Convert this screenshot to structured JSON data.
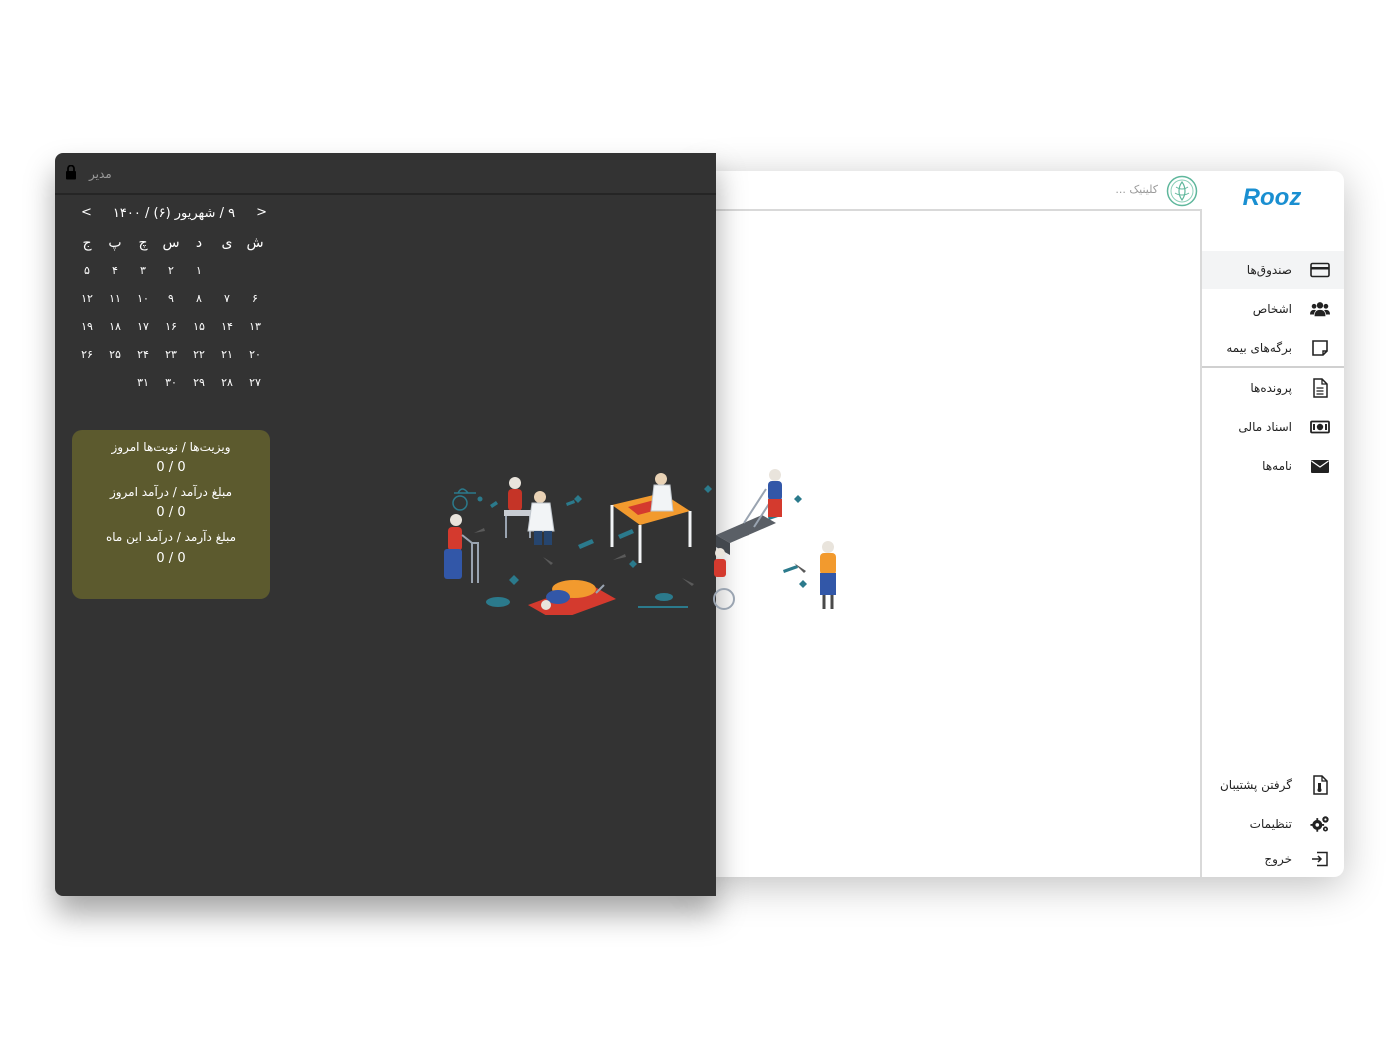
{
  "app": {
    "logo_text": "Rooz",
    "clinic_placeholder": "کلینیک ...",
    "brand_color": "#1a8fd1"
  },
  "sidebar": {
    "items": [
      {
        "label": "صندوق‌ها",
        "icon": "credit-card-icon",
        "active": true
      },
      {
        "label": "اشخاص",
        "icon": "users-icon"
      },
      {
        "label": "برگه‌های بیمه",
        "icon": "sticky-note-icon"
      },
      {
        "label": "پرونده‌ها",
        "icon": "document-icon"
      },
      {
        "label": "اسناد مالی",
        "icon": "money-bill-icon"
      },
      {
        "label": "نامه‌ها",
        "icon": "envelope-icon"
      }
    ],
    "bottom_items": [
      {
        "label": "گرفتن پشتیبان",
        "icon": "backup-file-icon"
      },
      {
        "label": "تنظیمات",
        "icon": "gears-icon"
      },
      {
        "label": "خروج",
        "icon": "sign-out-icon"
      }
    ]
  },
  "dark_panel": {
    "user_label": "مدیر",
    "calendar": {
      "prev": "<",
      "next": ">",
      "title": "۹ / شهریور (۶) / ۱۴۰۰",
      "weekdays": [
        "ش",
        "ی",
        "د",
        "س",
        "چ",
        "پ",
        "ج"
      ],
      "weeks": [
        [
          "",
          "",
          "۱",
          "۲",
          "۳",
          "۴",
          "۵"
        ],
        [
          "۶",
          "۷",
          "۸",
          "۹",
          "۱۰",
          "۱۱",
          "۱۲"
        ],
        [
          "۱۳",
          "۱۴",
          "۱۵",
          "۱۶",
          "۱۷",
          "۱۸",
          "۱۹"
        ],
        [
          "۲۰",
          "۲۱",
          "۲۲",
          "۲۳",
          "۲۴",
          "۲۵",
          "۲۶"
        ],
        [
          "۲۷",
          "۲۸",
          "۲۹",
          "۳۰",
          "۳۱",
          "",
          ""
        ]
      ]
    },
    "stats": [
      {
        "label": "ویزیت‌ها / نوبت‌ها امروز",
        "value": "0 / 0"
      },
      {
        "label": "مبلغ درآمد / درآمد امروز",
        "value": "0 / 0"
      },
      {
        "label": "مبلغ دآرمد / درآمد این ماه",
        "value": "0 / 0"
      }
    ]
  }
}
